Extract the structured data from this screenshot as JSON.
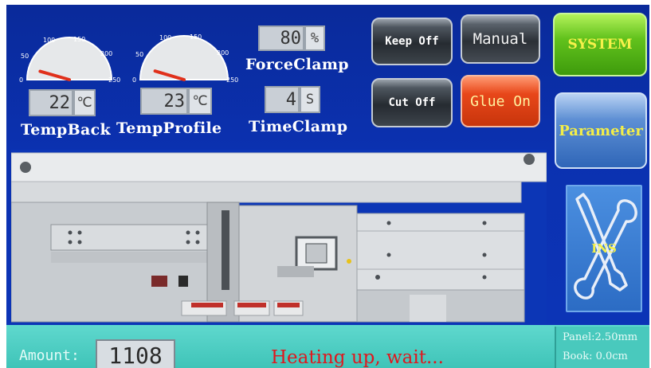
{
  "gauges": [
    {
      "name": "temp-back",
      "ticks": [
        "0",
        "50",
        "100",
        "150",
        "200",
        "250"
      ],
      "needle_value": 22,
      "max": 250
    },
    {
      "name": "temp-profile",
      "ticks": [
        "0",
        "50",
        "100",
        "150",
        "200",
        "250"
      ],
      "needle_value": 23,
      "max": 250
    }
  ],
  "temp_back": {
    "value": "22",
    "unit": "℃",
    "label": "TempBack"
  },
  "temp_profile": {
    "value": "23",
    "unit": "℃",
    "label": "TempProfile"
  },
  "force_clamp": {
    "value": "80",
    "unit": "%",
    "label": "ForceClamp"
  },
  "time_clamp": {
    "value": "4",
    "unit": "S",
    "label": "TimeClamp"
  },
  "buttons": {
    "keep_off": "Keep Off",
    "manual": "Manual",
    "cut_off": "Cut Off",
    "glue_on": "Glue On",
    "system": "SYSTEM",
    "parameter": "Parameter",
    "ins": "INS"
  },
  "status": {
    "amount_label": "Amount:",
    "amount_value": "1108",
    "message": "Heating up, wait...",
    "panel": "Panel:2.50mm",
    "book": "Book: 0.0cm"
  },
  "colors": {
    "screen_bg": "#0b31b0",
    "status_bar": "#3fc4b8",
    "message_red": "#e0171d",
    "label_yellow": "#f3ee48"
  }
}
